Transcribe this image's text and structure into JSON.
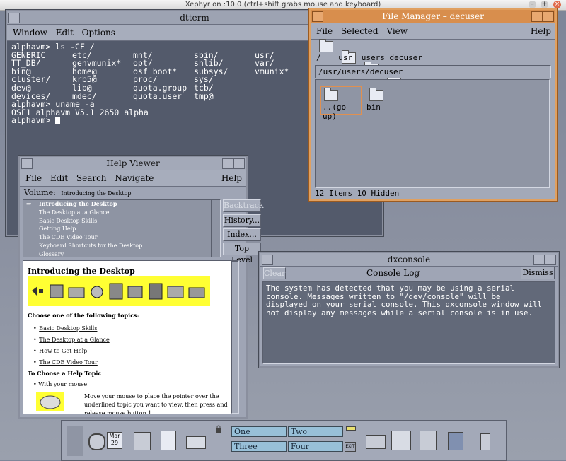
{
  "xephyr": {
    "title": "Xephyr on :10.0 (ctrl+shift grabs mouse and keyboard)"
  },
  "dtterm": {
    "title": "dtterm",
    "menu": [
      "Window",
      "Edit",
      "Options"
    ],
    "prompt1": "alphavm> ls -CF /",
    "ls": [
      "GENERIC",
      "etc/",
      "mnt/",
      "sbin/",
      "usr/",
      "",
      "TT_DB/",
      "genvmunix*",
      "opt/",
      "shlib/",
      "var/",
      "",
      "bin@",
      "home@",
      "osf_boot*",
      "subsys/",
      "vmunix*",
      "",
      "cluster/",
      "krb5@",
      "proc/",
      "sys/",
      "",
      "",
      "dev@",
      "lib@",
      "quota.group",
      "tcb/",
      "",
      "",
      "devices/",
      "mdec/",
      "quota.user",
      "tmp@",
      "",
      ""
    ],
    "prompt2": "alphavm> uname -a",
    "uname_out": "OSF1 alphavm V5.1 2650 alpha",
    "prompt3": "alphavm> "
  },
  "fileman": {
    "title": "File Manager – decuser",
    "menu": [
      "File",
      "Selected",
      "View"
    ],
    "help": "Help",
    "crumbs": [
      "/",
      "usr",
      "users",
      "decuser"
    ],
    "path": "/usr/users/decuser",
    "items": [
      "..(go up)",
      "bin"
    ],
    "status": "12 Items 10 Hidden"
  },
  "helpviewer": {
    "title": "Help Viewer",
    "menu": [
      "File",
      "Edit",
      "Search",
      "Navigate"
    ],
    "help": "Help",
    "volume_label": "Volume:",
    "volume": "Introducing the Desktop",
    "topics": [
      "Introducing the Desktop",
      "The Desktop at a Glance",
      "Basic Desktop Skills",
      "Getting Help",
      "The CDE Video Tour",
      "Keyboard Shortcuts for the Desktop",
      "Glossary"
    ],
    "buttons": [
      "Backtrack",
      "History...",
      "Index...",
      "Top Level"
    ],
    "heading": "Introducing the Desktop",
    "choose": "Choose one of the following topics:",
    "links": [
      "Basic Desktop Skills",
      "The Desktop at a Glance",
      "How to Get Help",
      "The CDE Video Tour"
    ],
    "subheading": "To Choose a Help Topic",
    "bullet": "With your mouse:",
    "instruction": "Move your mouse to place the pointer over the underlined topic you want to view, then press and release mouse button 1."
  },
  "dxconsole": {
    "title": "dxconsole",
    "clear": "Clear",
    "log_title": "Console Log",
    "dismiss": "Dismiss",
    "message": "The system has detected that you may be using a serial\nconsole. Messages written to \"/dev/console\" will be\ndisplayed on your serial console. This dxconsole window will\nnot display any messages while a serial console is in use."
  },
  "panel": {
    "date_month": "Mar",
    "date_day": "29",
    "workspaces": [
      "One",
      "Two",
      "Three",
      "Four"
    ],
    "exit": "EXIT"
  },
  "colors": {
    "accent": "#d88e4d",
    "window": "#9fa5b5",
    "terminal": "#535a6b",
    "workspace": "#98c0d8"
  }
}
